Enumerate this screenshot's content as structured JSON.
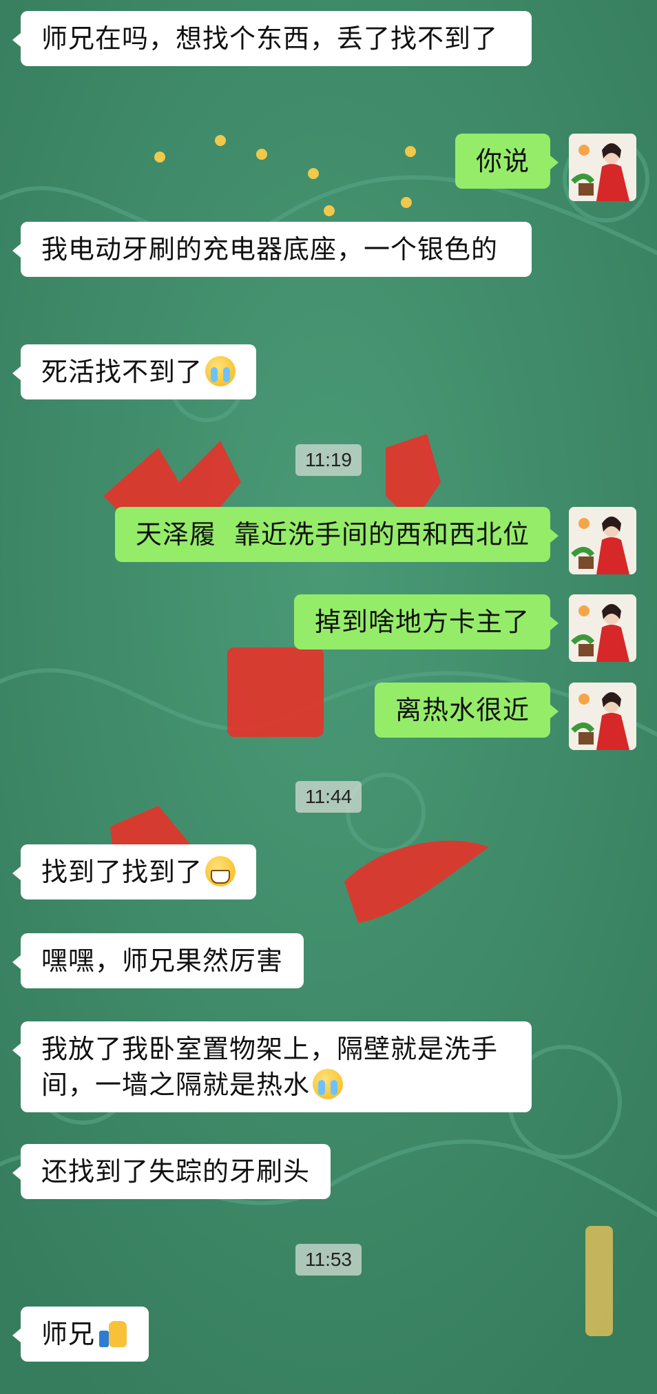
{
  "colors": {
    "background": "#3f8a68",
    "incoming_bubble": "#ffffff",
    "outgoing_bubble": "#95ec69"
  },
  "messages": [
    {
      "side": "in",
      "text": "师兄在吗，想找个东西，丢了找不到了",
      "emoji": ""
    },
    {
      "side": "out",
      "text": "你说",
      "emoji": ""
    },
    {
      "side": "in",
      "text": "我电动牙刷的充电器底座，一个银色的",
      "emoji": ""
    },
    {
      "side": "in",
      "text": "死活找不到了",
      "emoji": "crying-face"
    },
    {
      "side": "time",
      "text": "11:19"
    },
    {
      "side": "out",
      "text": "天泽履  靠近洗手间的西和西北位",
      "emoji": ""
    },
    {
      "side": "out",
      "text": "掉到啥地方卡主了",
      "emoji": ""
    },
    {
      "side": "out",
      "text": "离热水很近",
      "emoji": ""
    },
    {
      "side": "time",
      "text": "11:44"
    },
    {
      "side": "in",
      "text": "找到了找到了",
      "emoji": "grinning-face"
    },
    {
      "side": "in",
      "text": "嘿嘿，师兄果然厉害",
      "emoji": ""
    },
    {
      "side": "in",
      "text": "我放了我卧室置物架上，隔壁就是洗手间，一墙之隔就是热水",
      "emoji": "crying-face"
    },
    {
      "side": "in",
      "text": "还找到了失踪的牙刷头",
      "emoji": ""
    },
    {
      "side": "time",
      "text": "11:53"
    },
    {
      "side": "in",
      "text": "师兄",
      "emoji": "thumbs-up"
    }
  ]
}
